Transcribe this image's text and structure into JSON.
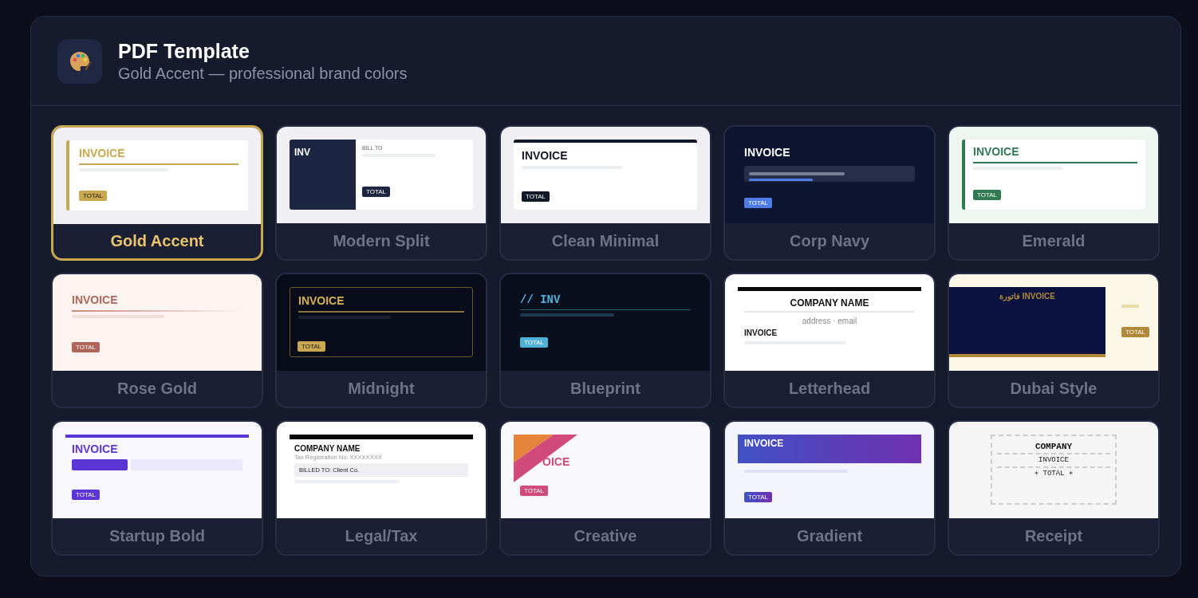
{
  "header": {
    "title": "PDF Template",
    "subtitle": "Gold Accent — professional brand colors"
  },
  "templates": [
    {
      "kind": "gold",
      "name": "Gold Accent",
      "selected": true,
      "title": "INVOICE",
      "badge": "TOTAL"
    },
    {
      "kind": "split",
      "name": "Modern Split",
      "selected": false,
      "title": "INV",
      "label": "BILL TO",
      "badge": "TOTAL"
    },
    {
      "kind": "minimal",
      "name": "Clean Minimal",
      "selected": false,
      "title": "INVOICE",
      "badge": "TOTAL"
    },
    {
      "kind": "navy",
      "name": "Corp Navy",
      "selected": false,
      "title": "INVOICE",
      "badge": "TOTAL"
    },
    {
      "kind": "emerald",
      "name": "Emerald",
      "selected": false,
      "title": "INVOICE",
      "badge": "TOTAL"
    },
    {
      "kind": "rose",
      "name": "Rose Gold",
      "selected": false,
      "title": "INVOICE",
      "badge": "TOTAL"
    },
    {
      "kind": "midnight",
      "name": "Midnight",
      "selected": false,
      "title": "INVOICE",
      "badge": "TOTAL"
    },
    {
      "kind": "blueprint",
      "name": "Blueprint",
      "selected": false,
      "title": "// INV",
      "badge": "TOTAL"
    },
    {
      "kind": "letterhead",
      "name": "Letterhead",
      "selected": false,
      "heading": "COMPANY NAME",
      "detail": "address · email",
      "title": "INVOICE"
    },
    {
      "kind": "dubai",
      "name": "Dubai Style",
      "selected": false,
      "title": "فاتورة INVOICE",
      "badge": "TOTAL"
    },
    {
      "kind": "startup",
      "name": "Startup Bold",
      "selected": false,
      "title": "INVOICE",
      "badge": "TOTAL"
    },
    {
      "kind": "legal",
      "name": "Legal/Tax",
      "selected": false,
      "heading": "COMPANY NAME",
      "detail": "Tax Registration No: XXXXXXXX",
      "bill": "BILLED TO: Client Co."
    },
    {
      "kind": "creative",
      "name": "Creative",
      "selected": false,
      "title": "OICE",
      "badge": "TOTAL"
    },
    {
      "kind": "gradient",
      "name": "Gradient",
      "selected": false,
      "title": "INVOICE",
      "badge": "TOTAL"
    },
    {
      "kind": "receipt",
      "name": "Receipt",
      "selected": false,
      "heading": "COMPANY",
      "title": "INVOICE",
      "badge": "∗ TOTAL ∗"
    }
  ]
}
